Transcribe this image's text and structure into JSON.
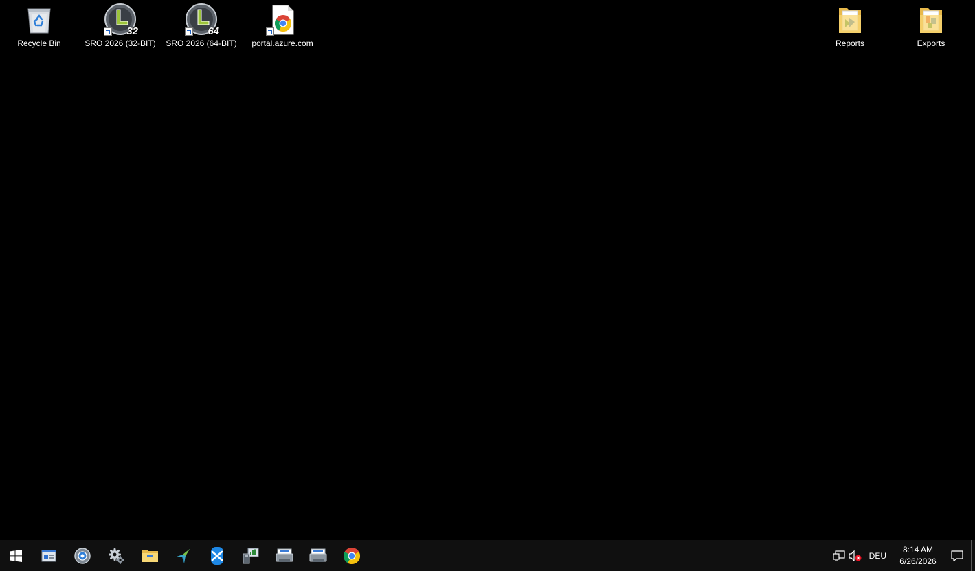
{
  "desktop": {
    "icons": [
      {
        "name": "recycle-bin",
        "label": "Recycle Bin"
      },
      {
        "name": "sro-2026-32bit",
        "label": "SRO 2026 (32-BIT)",
        "badge": "32"
      },
      {
        "name": "sro-2026-64bit",
        "label": "SRO 2026 (64-BIT)",
        "badge": "64"
      },
      {
        "name": "portal-azure",
        "label": "portal.azure.com"
      },
      {
        "name": "reports-folder",
        "label": "Reports"
      },
      {
        "name": "exports-folder",
        "label": "Exports"
      }
    ]
  },
  "taskbar": {
    "pinned": [
      {
        "name": "start-button",
        "icon": "windows-logo-icon"
      },
      {
        "name": "taskbar-server-manager",
        "icon": "server-manager-icon"
      },
      {
        "name": "taskbar-control-panel",
        "icon": "control-panel-icon"
      },
      {
        "name": "taskbar-settings",
        "icon": "gear-icon"
      },
      {
        "name": "taskbar-file-explorer",
        "icon": "folder-icon"
      },
      {
        "name": "taskbar-hummingbird",
        "icon": "hummingbird-icon"
      },
      {
        "name": "taskbar-sql-app",
        "icon": "database-icon"
      },
      {
        "name": "taskbar-remote-desktop",
        "icon": "remote-desktop-icon"
      },
      {
        "name": "taskbar-printer-1",
        "icon": "printer-icon"
      },
      {
        "name": "taskbar-printer-2",
        "icon": "printer-icon"
      },
      {
        "name": "taskbar-chrome",
        "icon": "chrome-icon"
      }
    ],
    "tray": {
      "network_icon": "network-icon",
      "volume_icon": "volume-muted-icon",
      "language": "DEU",
      "time": "8:14 AM",
      "date": "6/26/2026",
      "notification_icon": "action-center-icon"
    }
  },
  "colors": {
    "desktop_background": "#000000",
    "taskbar_background": "#101010",
    "sro_accent": "#9cc43a",
    "chrome_red": "#db4437",
    "chrome_yellow": "#f4c20d",
    "chrome_green": "#0f9d58",
    "chrome_blue": "#4285f4",
    "folder_yellow": "#f8d775"
  }
}
